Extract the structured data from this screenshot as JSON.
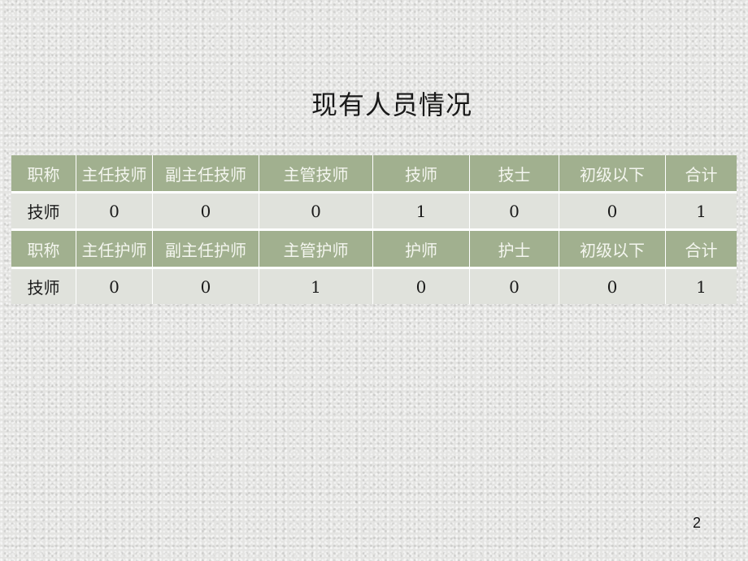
{
  "title": "现有人员情况",
  "tables": [
    {
      "headers": [
        "职称",
        "主任技师",
        "副主任技师",
        "主管技师",
        "技师",
        "技士",
        "初级以下",
        "合计"
      ],
      "row": [
        "技师",
        "0",
        "0",
        "0",
        "1",
        "0",
        "0",
        "1"
      ]
    },
    {
      "headers": [
        "职称",
        "主任护师",
        "副主任护师",
        "主管护师",
        "护师",
        "护士",
        "初级以下",
        "合计"
      ],
      "row": [
        "技师",
        "0",
        "0",
        "1",
        "0",
        "0",
        "0",
        "1"
      ]
    }
  ],
  "page_number": "2",
  "colors": {
    "header_bg": "#a1b08f",
    "row_bg": "#e0e2dc"
  }
}
